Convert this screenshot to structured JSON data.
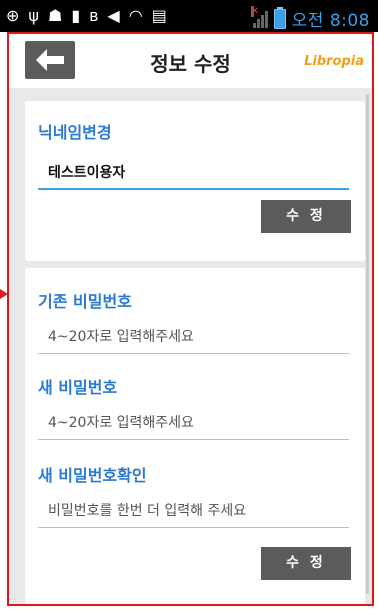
{
  "statusbar": {
    "time": "오전 8:08",
    "icons": [
      "add-icon",
      "usb-icon",
      "android-debug-icon",
      "battery-mini-icon",
      "bluetooth-icon",
      "mute-icon",
      "wifi-icon",
      "no-sim-icon",
      "signal-icon",
      "battery-icon"
    ]
  },
  "header": {
    "title": "정보 수정",
    "brand": "Libropia"
  },
  "nickname_card": {
    "label": "닉네임변경",
    "value": "테스트이용자",
    "button": "수 정"
  },
  "password_card": {
    "current_label": "기존 비밀번호",
    "current_placeholder": "4~20자로 입력해주세요",
    "new_label": "새 비밀번호",
    "new_placeholder": "4~20자로 입력해주세요",
    "confirm_label": "새 비밀번호확인",
    "confirm_placeholder": "비밀번호를 한번 더 입력해 주세요",
    "button": "수 정"
  },
  "colors": {
    "accent_blue": "#2a7ad4",
    "brand_orange": "#f0a018",
    "button_gray": "#5b5b5b",
    "highlight_red": "#e01818"
  }
}
